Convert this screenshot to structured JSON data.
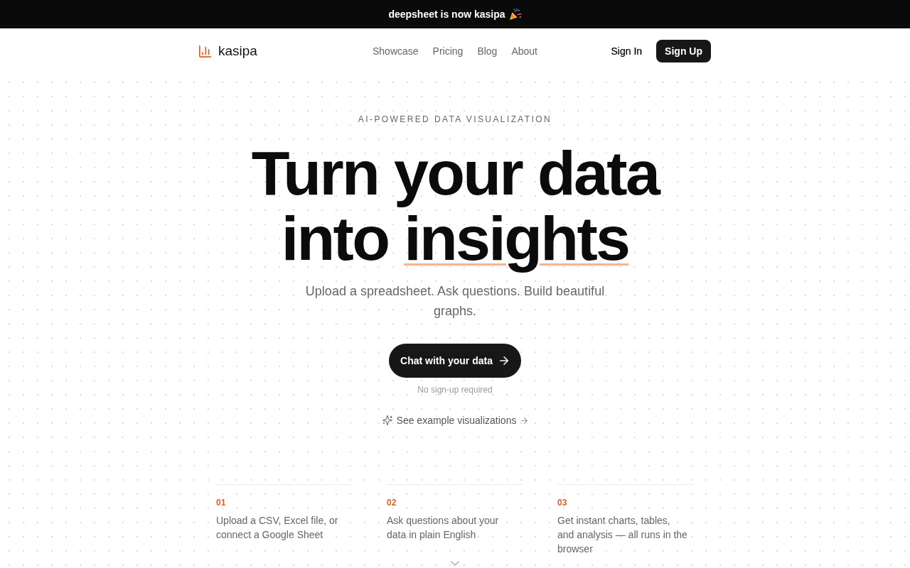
{
  "announcement": {
    "text": "deepsheet is now kasipa"
  },
  "nav": {
    "brand": "kasipa",
    "links": [
      "Showcase",
      "Pricing",
      "Blog",
      "About"
    ],
    "sign_in": "Sign In",
    "sign_up": "Sign Up"
  },
  "hero": {
    "eyebrow": "AI-POWERED DATA VISUALIZATION",
    "headline": {
      "first_line": "Turn your data",
      "second_line": "into",
      "underlined_word": "insights"
    },
    "subtitle": "Upload a spreadsheet. Ask questions. Build beautiful graphs.",
    "cta": "Chat with your data",
    "cta_note": "No sign-up required",
    "examples_link": "See example visualizations"
  },
  "steps": [
    {
      "number": "01",
      "text": "Upload a CSV, Excel file, or connect a Google Sheet"
    },
    {
      "number": "02",
      "text": "Ask questions about your data in plain English"
    },
    {
      "number": "03",
      "text": "Get instant charts, tables, and analysis — all runs in the browser"
    }
  ]
}
